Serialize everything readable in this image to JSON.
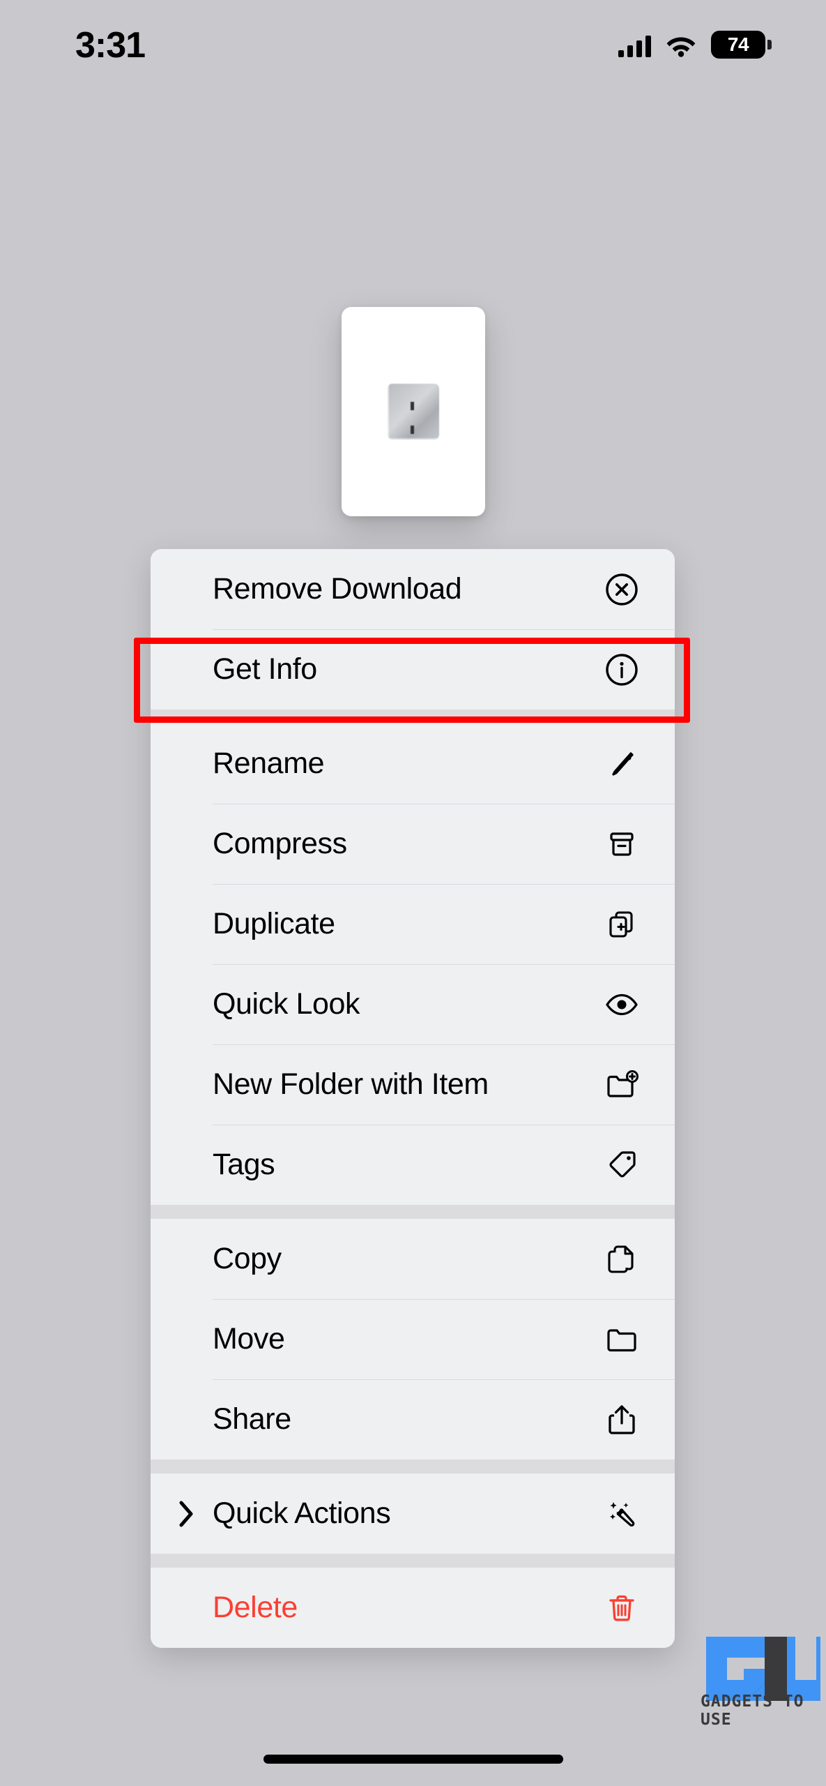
{
  "status_bar": {
    "time": "3:31",
    "cellular_icon": "cellular-bars-icon",
    "wifi_icon": "wifi-icon",
    "battery_level": "74",
    "battery_icon": "battery-icon"
  },
  "file_preview": {
    "thumbnail_icon": "document-thumbnail",
    "description": "White document page thumbnail with small grayscale image preview"
  },
  "context_menu": {
    "groups": [
      {
        "items": [
          {
            "label": "Remove Download",
            "icon": "x-circle-icon",
            "destructive": false,
            "has_submenu": false
          },
          {
            "label": "Get Info",
            "icon": "info-circle-icon",
            "destructive": false,
            "has_submenu": false,
            "highlighted": true
          }
        ]
      },
      {
        "items": [
          {
            "label": "Rename",
            "icon": "pencil-icon",
            "destructive": false,
            "has_submenu": false
          },
          {
            "label": "Compress",
            "icon": "archive-box-icon",
            "destructive": false,
            "has_submenu": false
          },
          {
            "label": "Duplicate",
            "icon": "duplicate-icon",
            "destructive": false,
            "has_submenu": false
          },
          {
            "label": "Quick Look",
            "icon": "eye-icon",
            "destructive": false,
            "has_submenu": false
          },
          {
            "label": "New Folder with Item",
            "icon": "folder-plus-icon",
            "destructive": false,
            "has_submenu": false
          },
          {
            "label": "Tags",
            "icon": "tag-icon",
            "destructive": false,
            "has_submenu": false
          }
        ]
      },
      {
        "items": [
          {
            "label": "Copy",
            "icon": "copy-documents-icon",
            "destructive": false,
            "has_submenu": false
          },
          {
            "label": "Move",
            "icon": "folder-icon",
            "destructive": false,
            "has_submenu": false
          },
          {
            "label": "Share",
            "icon": "share-icon",
            "destructive": false,
            "has_submenu": false
          }
        ]
      },
      {
        "items": [
          {
            "label": "Quick Actions",
            "icon": "magic-wand-icon",
            "destructive": false,
            "has_submenu": true,
            "submenu_icon": "chevron-right-icon"
          }
        ]
      },
      {
        "items": [
          {
            "label": "Delete",
            "icon": "trash-icon",
            "destructive": true,
            "has_submenu": false
          }
        ]
      }
    ]
  },
  "highlight": {
    "target_label": "Get Info",
    "color": "#ff0000"
  },
  "watermark": {
    "text": "GADGETS TO USE",
    "logo_icon": "gadgets-to-use-logo",
    "brand_color": "#3f94f5",
    "dark_color": "#3a3a3c"
  },
  "home_indicator": {
    "icon": "home-indicator"
  },
  "colors": {
    "background": "#c9c9cd",
    "menu_row": "#eff0f2",
    "menu_separator": "#dcdcde",
    "destructive": "#fa3f32",
    "highlight": "#ff0000"
  }
}
